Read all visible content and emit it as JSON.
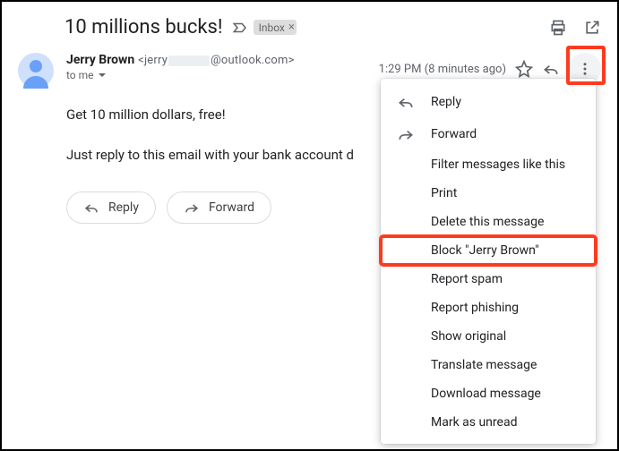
{
  "subject": "10 millions bucks!",
  "inbox_chip": "Inbox",
  "sender": {
    "name": "Jerry Brown",
    "email_prefix": "<jerry",
    "email_suffix": "@outlook.com>"
  },
  "recipient_line": "to me",
  "timestamp": "1:29 PM (8 minutes ago)",
  "body": {
    "line1": "Get 10 million dollars, free!",
    "line2": "Just reply to this email with your bank account d"
  },
  "buttons": {
    "reply": "Reply",
    "forward": "Forward"
  },
  "menu": {
    "reply": "Reply",
    "forward": "Forward",
    "filter": "Filter messages like this",
    "print": "Print",
    "delete": "Delete this message",
    "block": "Block \"Jerry Brown\"",
    "spam": "Report spam",
    "phishing": "Report phishing",
    "show_original": "Show original",
    "translate": "Translate message",
    "download": "Download message",
    "mark_unread": "Mark as unread"
  }
}
